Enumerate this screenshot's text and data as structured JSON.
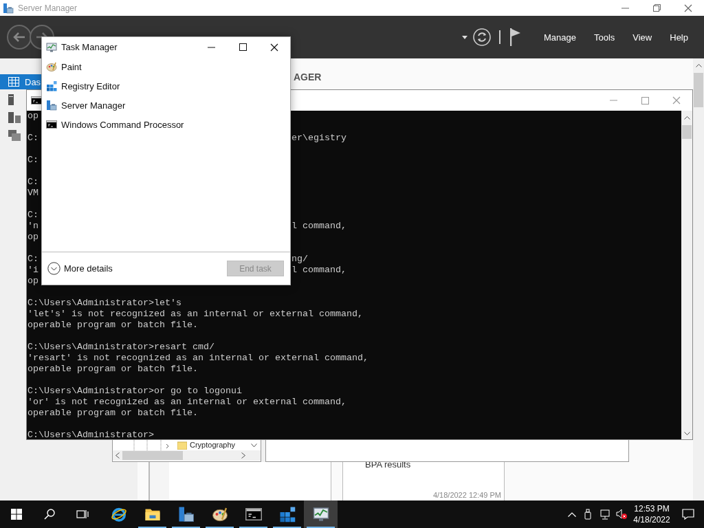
{
  "server_manager": {
    "title": "Server Manager",
    "menu": [
      "Manage",
      "Tools",
      "View",
      "Help"
    ],
    "sidebar": [
      {
        "kind": "dashboard",
        "label": "Das",
        "selected": true
      },
      {
        "kind": "local",
        "selected": false
      },
      {
        "kind": "all",
        "selected": false
      },
      {
        "kind": "files",
        "selected": false
      }
    ],
    "heading": "AGER",
    "tile": {
      "label": "BPA results",
      "time": "4/18/2022 12:49 PM"
    }
  },
  "registry_editor": {
    "tree_item": "Cryptography"
  },
  "command_prompt": {
    "lines": [
      {
        "kind": "split",
        "left": "op"
      },
      {
        "kind": "blank"
      },
      {
        "kind": "split",
        "left": "C:",
        "right": "er\\egistry"
      },
      {
        "kind": "blank"
      },
      {
        "kind": "split",
        "left": "C:"
      },
      {
        "kind": "blank"
      },
      {
        "kind": "split",
        "left": "C:"
      },
      {
        "kind": "split",
        "left": "VM"
      },
      {
        "kind": "blank"
      },
      {
        "kind": "split",
        "left": "C:"
      },
      {
        "kind": "split",
        "left": "'n",
        "right": "l command,"
      },
      {
        "kind": "split",
        "left": "op"
      },
      {
        "kind": "blank"
      },
      {
        "kind": "split",
        "left": "C:",
        "right": "ng/"
      },
      {
        "kind": "split",
        "left": "'i",
        "right": "l command,"
      },
      {
        "kind": "split",
        "left": "op"
      },
      {
        "kind": "blank"
      },
      {
        "kind": "full",
        "text": "C:\\Users\\Administrator>let's"
      },
      {
        "kind": "full",
        "text": "'let's' is not recognized as an internal or external command,"
      },
      {
        "kind": "full",
        "text": "operable program or batch file."
      },
      {
        "kind": "blank"
      },
      {
        "kind": "full",
        "text": "C:\\Users\\Administrator>resart cmd/"
      },
      {
        "kind": "full",
        "text": "'resart' is not recognized as an internal or external command,"
      },
      {
        "kind": "full",
        "text": "operable program or batch file."
      },
      {
        "kind": "blank"
      },
      {
        "kind": "full",
        "text": "C:\\Users\\Administrator>or go to logonui"
      },
      {
        "kind": "full",
        "text": "'or' is not recognized as an internal or external command,"
      },
      {
        "kind": "full",
        "text": "operable program or batch file."
      },
      {
        "kind": "blank"
      },
      {
        "kind": "full",
        "text": "C:\\Users\\Administrator>"
      }
    ]
  },
  "task_manager": {
    "title": "Task Manager",
    "apps": [
      {
        "kind": "paint",
        "name": "Paint"
      },
      {
        "kind": "registry",
        "name": "Registry Editor"
      },
      {
        "kind": "server",
        "name": "Server Manager"
      },
      {
        "kind": "cmd",
        "name": "Windows Command Processor"
      }
    ],
    "more_details": "More details",
    "end_task": {
      "label": "End task",
      "disabled": true
    }
  },
  "taskbar": {
    "apps": [
      {
        "kind": "ie",
        "running": false,
        "selected": false
      },
      {
        "kind": "explorer",
        "running": true,
        "selected": false
      },
      {
        "kind": "server",
        "running": true,
        "selected": false
      },
      {
        "kind": "paint",
        "running": true,
        "selected": false
      },
      {
        "kind": "cmd",
        "running": true,
        "selected": false
      },
      {
        "kind": "registry",
        "running": true,
        "selected": false
      },
      {
        "kind": "taskmgr",
        "running": true,
        "selected": true
      }
    ],
    "clock": {
      "time": "12:53 PM",
      "date": "4/18/2022"
    }
  }
}
